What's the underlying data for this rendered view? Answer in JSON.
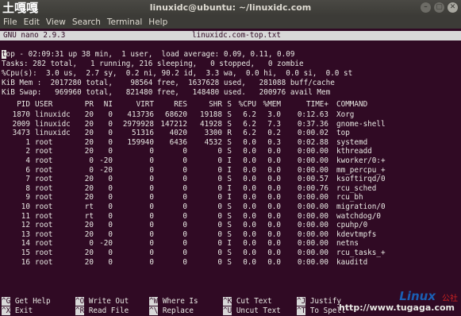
{
  "window": {
    "logo_text": "土嘎嘎",
    "title": "linuxidc@ubuntu: ~/linuxidc.com",
    "buttons": [
      "–",
      "▢",
      "✕"
    ]
  },
  "menubar": [
    "File",
    "Edit",
    "View",
    "Search",
    "Terminal",
    "Help"
  ],
  "nano": {
    "version": "GNU nano 2.9.3",
    "filename": "linuxidc.com-top.txt"
  },
  "summary": {
    "line1_cursor": "t",
    "line1": "op - 02:09:31 up 38 min,  1 user,  load average: 0.09, 0.11, 0.09",
    "line2": "Tasks: 282 total,   1 running, 216 sleeping,   0 stopped,   0 zombie",
    "line3": "%Cpu(s):  3.0 us,  2.7 sy,  0.2 ni, 90.2 id,  3.3 wa,  0.0 hi,  0.0 si,  0.0 st",
    "line4": "KiB Mem :  2017280 total,    98564 free,  1637628 used,   281088 buff/cache",
    "line5": "KiB Swap:   969960 total,   821480 free,   148480 used.   200976 avail Mem"
  },
  "table": {
    "headers": [
      "PID",
      "USER",
      "PR",
      "NI",
      "VIRT",
      "RES",
      "SHR",
      "S",
      "%CPU",
      "%MEM",
      "TIME+",
      "COMMAND"
    ],
    "rows": [
      [
        "1870",
        "linuxidc",
        "20",
        "0",
        "413736",
        "68620",
        "19188",
        "S",
        "6.2",
        "3.0",
        "0:12.63",
        "Xorg"
      ],
      [
        "2009",
        "linuxidc",
        "20",
        "0",
        "2979928",
        "147212",
        "41928",
        "S",
        "6.2",
        "7.3",
        "0:37.36",
        "gnome-shell"
      ],
      [
        "3473",
        "linuxidc",
        "20",
        "0",
        "51316",
        "4020",
        "3300",
        "R",
        "6.2",
        "0.2",
        "0:00.02",
        "top"
      ],
      [
        "1",
        "root",
        "20",
        "0",
        "159940",
        "6436",
        "4532",
        "S",
        "0.0",
        "0.3",
        "0:02.88",
        "systemd"
      ],
      [
        "2",
        "root",
        "20",
        "0",
        "0",
        "0",
        "0",
        "S",
        "0.0",
        "0.0",
        "0:00.00",
        "kthreadd"
      ],
      [
        "4",
        "root",
        "0",
        "-20",
        "0",
        "0",
        "0",
        "I",
        "0.0",
        "0.0",
        "0:00.00",
        "kworker/0:+"
      ],
      [
        "6",
        "root",
        "0",
        "-20",
        "0",
        "0",
        "0",
        "I",
        "0.0",
        "0.0",
        "0:00.00",
        "mm_percpu_+"
      ],
      [
        "7",
        "root",
        "20",
        "0",
        "0",
        "0",
        "0",
        "S",
        "0.0",
        "0.0",
        "0:00.57",
        "ksoftirqd/0"
      ],
      [
        "8",
        "root",
        "20",
        "0",
        "0",
        "0",
        "0",
        "I",
        "0.0",
        "0.0",
        "0:00.76",
        "rcu_sched"
      ],
      [
        "9",
        "root",
        "20",
        "0",
        "0",
        "0",
        "0",
        "I",
        "0.0",
        "0.0",
        "0:00.00",
        "rcu_bh"
      ],
      [
        "10",
        "root",
        "rt",
        "0",
        "0",
        "0",
        "0",
        "S",
        "0.0",
        "0.0",
        "0:00.00",
        "migration/0"
      ],
      [
        "11",
        "root",
        "rt",
        "0",
        "0",
        "0",
        "0",
        "S",
        "0.0",
        "0.0",
        "0:00.00",
        "watchdog/0"
      ],
      [
        "12",
        "root",
        "20",
        "0",
        "0",
        "0",
        "0",
        "S",
        "0.0",
        "0.0",
        "0:00.00",
        "cpuhp/0"
      ],
      [
        "13",
        "root",
        "20",
        "0",
        "0",
        "0",
        "0",
        "S",
        "0.0",
        "0.0",
        "0:00.00",
        "kdevtmpfs"
      ],
      [
        "14",
        "root",
        "0",
        "-20",
        "0",
        "0",
        "0",
        "I",
        "0.0",
        "0.0",
        "0:00.00",
        "netns"
      ],
      [
        "15",
        "root",
        "20",
        "0",
        "0",
        "0",
        "0",
        "S",
        "0.0",
        "0.0",
        "0:00.00",
        "rcu_tasks_+"
      ],
      [
        "16",
        "root",
        "20",
        "0",
        "0",
        "0",
        "0",
        "S",
        "0.0",
        "0.0",
        "0:00.00",
        "kauditd"
      ]
    ]
  },
  "shortcuts": [
    {
      "key": "^G",
      "label": "Get Help"
    },
    {
      "key": "^O",
      "label": "Write Out"
    },
    {
      "key": "^W",
      "label": "Where Is"
    },
    {
      "key": "^K",
      "label": "Cut Text"
    },
    {
      "key": "^J",
      "label": "Justify"
    },
    {
      "key": "^X",
      "label": "Exit"
    },
    {
      "key": "^R",
      "label": "Read File"
    },
    {
      "key": "^\\",
      "label": "Replace"
    },
    {
      "key": "^U",
      "label": "Uncut Text"
    },
    {
      "key": "^T",
      "label": "To Spell"
    }
  ],
  "watermark": {
    "brand": "Linux",
    "brand_cn": "公社",
    "url": "http://www.tugaga.com"
  }
}
